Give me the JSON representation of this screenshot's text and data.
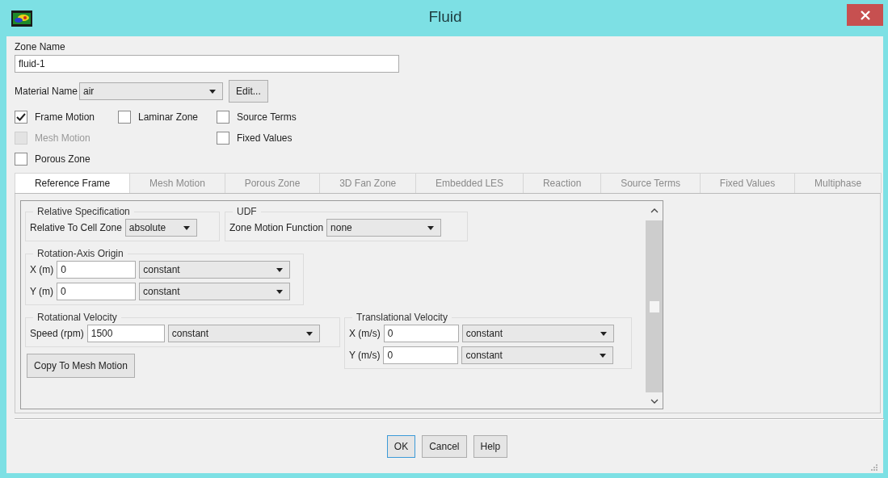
{
  "window": {
    "title": "Fluid"
  },
  "zone_name": {
    "label": "Zone Name",
    "value": "fluid-1"
  },
  "material": {
    "label": "Material Name",
    "value": "air",
    "button": "Edit..."
  },
  "option_columns": [
    [
      {
        "label": "Frame Motion",
        "checked": true,
        "disabled": false
      },
      {
        "label": "Mesh Motion",
        "checked": false,
        "disabled": true
      },
      {
        "label": "Porous Zone",
        "checked": false,
        "disabled": false
      }
    ],
    [
      {
        "label": "Laminar Zone",
        "checked": false,
        "disabled": false
      }
    ],
    [
      {
        "label": "Source Terms",
        "checked": false,
        "disabled": false
      },
      {
        "label": "Fixed Values",
        "checked": false,
        "disabled": false
      }
    ]
  ],
  "tabs": [
    {
      "label": "Reference Frame",
      "selected": true
    },
    {
      "label": "Mesh Motion",
      "selected": false
    },
    {
      "label": "Porous Zone",
      "selected": false
    },
    {
      "label": "3D Fan Zone",
      "selected": false
    },
    {
      "label": "Embedded LES",
      "selected": false
    },
    {
      "label": "Reaction",
      "selected": false
    },
    {
      "label": "Source Terms",
      "selected": false
    },
    {
      "label": "Fixed Values",
      "selected": false
    },
    {
      "label": "Multiphase",
      "selected": false
    }
  ],
  "reference_frame": {
    "relative_specification": {
      "title": "Relative Specification",
      "label": "Relative To Cell Zone",
      "value": "absolute"
    },
    "udf": {
      "title": "UDF",
      "label": "Zone Motion Function",
      "value": "none"
    },
    "rotation_axis_origin": {
      "title": "Rotation-Axis Origin",
      "rows": [
        {
          "label": "X (m)",
          "value": "0",
          "profile": "constant"
        },
        {
          "label": "Y (m)",
          "value": "0",
          "profile": "constant"
        }
      ]
    },
    "rotational_velocity": {
      "title": "Rotational Velocity",
      "rows": [
        {
          "label": "Speed (rpm)",
          "value": "1500",
          "profile": "constant"
        }
      ]
    },
    "copy_button": "Copy To Mesh Motion",
    "translational_velocity": {
      "title": "Translational Velocity",
      "rows": [
        {
          "label": "X (m/s)",
          "value": "0",
          "profile": "constant"
        },
        {
          "label": "Y (m/s)",
          "value": "0",
          "profile": "constant"
        }
      ]
    }
  },
  "buttons": [
    {
      "label": "OK",
      "focused": true
    },
    {
      "label": "Cancel",
      "focused": false
    },
    {
      "label": "Help",
      "focused": false
    }
  ]
}
